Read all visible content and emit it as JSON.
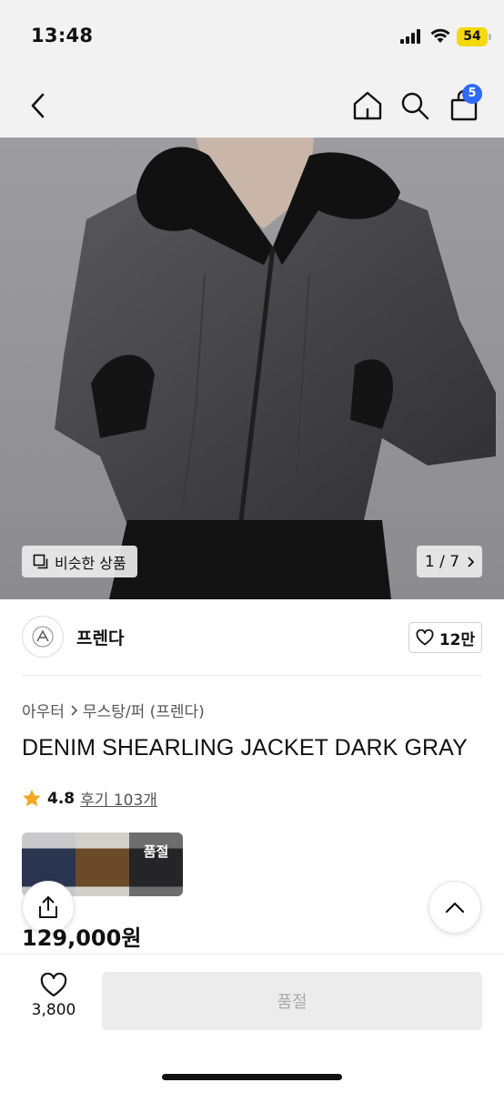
{
  "status_bar": {
    "time": "13:48",
    "battery": "54"
  },
  "nav": {
    "cart_count": "5"
  },
  "hero": {
    "similar_label": "비슷한 상품",
    "pager": "1 / 7"
  },
  "brand": {
    "name": "프렌다",
    "likes": "12만"
  },
  "breadcrumb": {
    "category": "아우터",
    "subcategory": "무스탕/퍼 (프렌다)"
  },
  "product": {
    "title": "DENIM SHEARLING JACKET DARK GRAY",
    "rating": "4.8",
    "reviews": "후기 103개",
    "price": "129,000원"
  },
  "variants": [
    {
      "color": "#2b3450",
      "label": ""
    },
    {
      "color": "#6b4a2a",
      "label": ""
    },
    {
      "color": "#3a3a3c",
      "label": "품절"
    }
  ],
  "bottom_bar": {
    "wish_count": "3,800",
    "buy_label": "품절"
  },
  "colors": {
    "accent": "#2f6bff",
    "star": "#f5a623",
    "battery": "#f5d90a"
  }
}
